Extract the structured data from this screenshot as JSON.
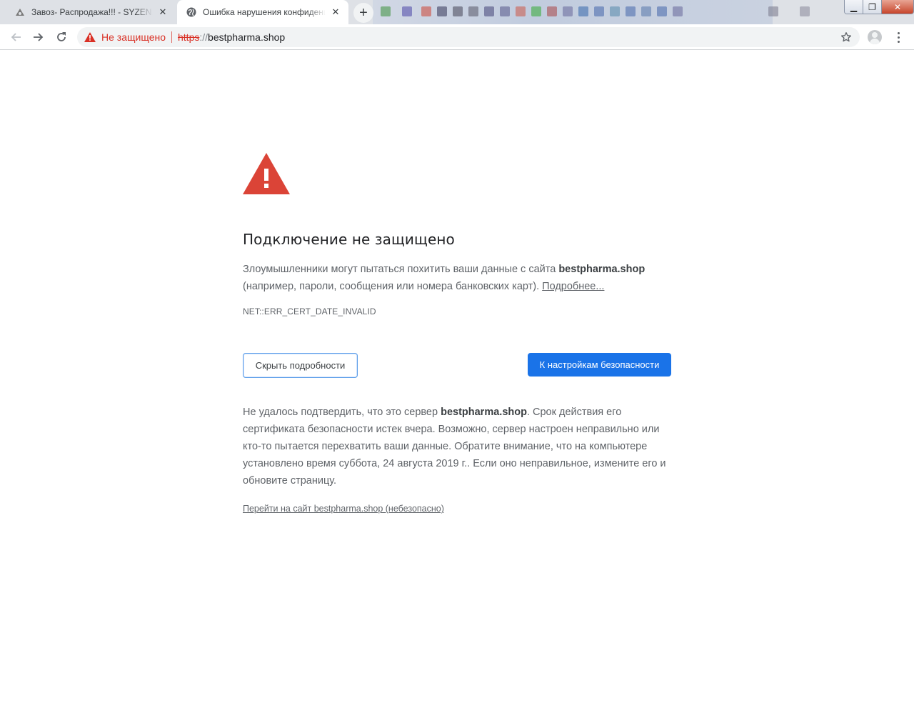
{
  "tabs": [
    {
      "title": "Завоз- Распродажа!!! - SYZEN.BY",
      "favicon": "site-favicon-icon",
      "close": "✕"
    },
    {
      "title": "Ошибка нарушения конфиденциальности",
      "favicon": "globe-icon",
      "close": "✕"
    }
  ],
  "newtab_label": "+",
  "window_controls": {
    "minimize": "▁",
    "maximize": "❐",
    "close": "✕"
  },
  "toolbar": {
    "back_icon": "arrow-left-icon",
    "forward_icon": "arrow-right-icon",
    "reload_icon": "reload-icon",
    "security_label": "Не защищено",
    "url_scheme": "https",
    "url_slashes": "://",
    "url_host": "bestpharma.shop",
    "bookmark_icon": "star-icon",
    "profile_icon": "avatar-icon",
    "menu_icon": "kebab-menu-icon"
  },
  "interstitial": {
    "heading": "Подключение не защищено",
    "p1_text": "Злоумышленники могут пытаться похитить ваши данные с сайта ",
    "p1_domain": "bestpharma.shop",
    "p1_rest": " (например, пароли, сообщения или номера банковских карт). ",
    "learn_more": "Подробнее...",
    "error_code": "NET::ERR_CERT_DATE_INVALID",
    "hide_details_button": "Скрыть подробности",
    "back_to_safety_button": "К настройкам безопасности",
    "details_text_start": "Не удалось подтвердить, что это сервер ",
    "details_domain": "bestpharma.shop",
    "details_text_rest": ". Срок действия его сертификата безопасности истек вчера. Возможно, сервер настроен неправильно или кто-то пытается перехватить ваши данные. Обратите внимание, что на компьютере установлено время суббота, 24 августа 2019 г.. Если оно неправильное, измените его и обновите страницу.",
    "proceed_link": "Перейти на сайт bestpharma.shop (небезопасно)"
  },
  "colors": {
    "danger_red": "#d93025",
    "warning_triangle": "#db4437",
    "primary_blue": "#1a73e8",
    "text_secondary": "#5f6368"
  }
}
